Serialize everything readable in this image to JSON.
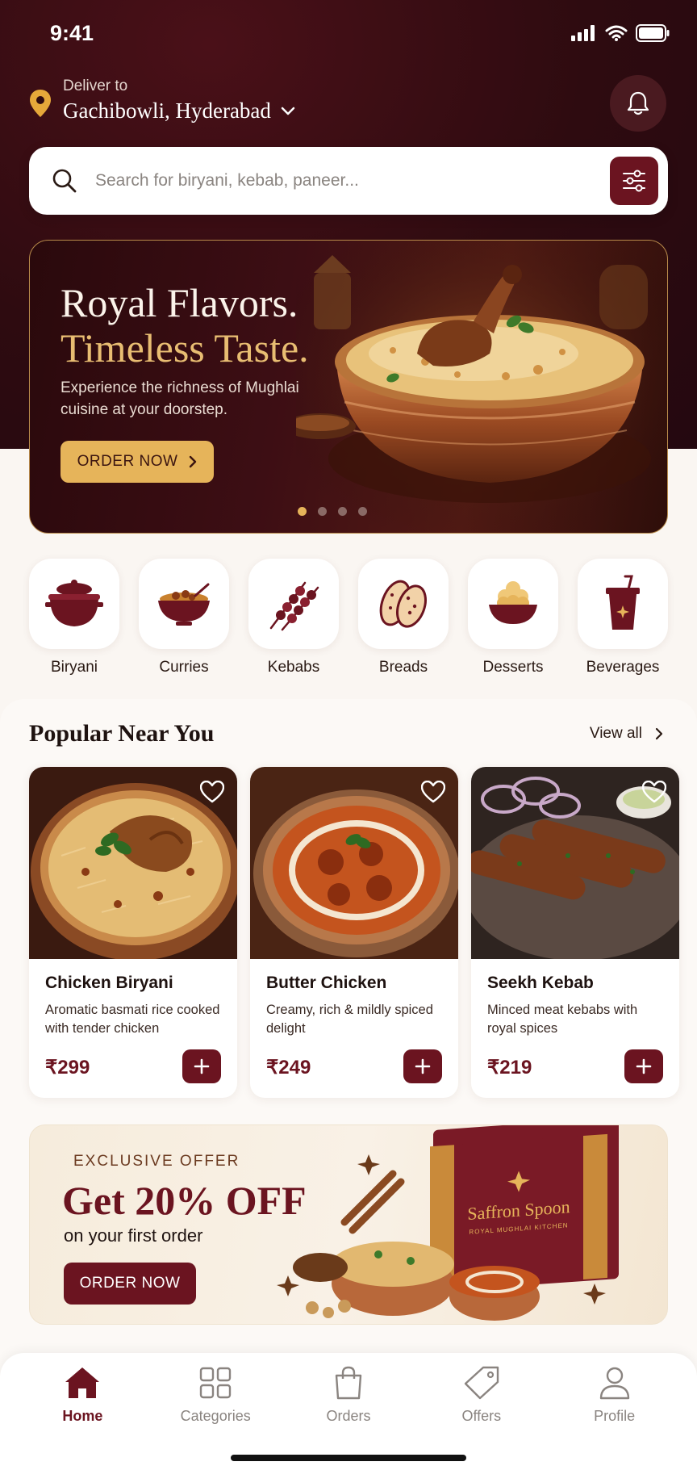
{
  "status": {
    "time": "9:41"
  },
  "location": {
    "label": "Deliver to",
    "city": "Gachibowli, Hyderabad"
  },
  "search": {
    "placeholder": "Search for biryani, kebab, paneer..."
  },
  "hero": {
    "title_line1": "Royal Flavors.",
    "title_line2": "Timeless Taste.",
    "subtitle": "Experience the richness of Mughlai cuisine at your doorstep.",
    "cta": "ORDER NOW",
    "slides": 4,
    "active_slide": 1
  },
  "categories": [
    {
      "label": "Biryani",
      "icon": "biryani-pot-icon"
    },
    {
      "label": "Curries",
      "icon": "curry-bowl-icon"
    },
    {
      "label": "Kebabs",
      "icon": "kebab-skewer-icon"
    },
    {
      "label": "Breads",
      "icon": "naan-bread-icon"
    },
    {
      "label": "Desserts",
      "icon": "dessert-bowl-icon"
    },
    {
      "label": "Beverages",
      "icon": "beverage-cup-icon"
    }
  ],
  "popular": {
    "title": "Popular Near You",
    "view_all": "View all",
    "items": [
      {
        "name": "Chicken Biryani",
        "desc": "Aromatic basmati rice cooked with tender chicken",
        "price": "₹299"
      },
      {
        "name": "Butter Chicken",
        "desc": "Creamy, rich & mildly spiced delight",
        "price": "₹249"
      },
      {
        "name": "Seekh Kebab",
        "desc": "Minced meat kebabs with royal spices",
        "price": "₹219"
      }
    ]
  },
  "offer": {
    "kicker": "EXCLUSIVE OFFER",
    "title": "Get 20% OFF",
    "subtitle": "on your first order",
    "cta": "ORDER NOW",
    "box_brand": "Saffron Spoon",
    "box_tagline": "ROYAL MUGHLAI KITCHEN"
  },
  "tabs": [
    {
      "label": "Home",
      "icon": "home-icon",
      "active": true
    },
    {
      "label": "Categories",
      "icon": "grid-icon",
      "active": false
    },
    {
      "label": "Orders",
      "icon": "shopping-bag-icon",
      "active": false
    },
    {
      "label": "Offers",
      "icon": "tag-icon",
      "active": false
    },
    {
      "label": "Profile",
      "icon": "user-icon",
      "active": false
    }
  ],
  "colors": {
    "brand": "#6b1420",
    "accent_gold": "#e6b45a",
    "header_dark": "#2e0b10",
    "background": "#faf6f2"
  }
}
